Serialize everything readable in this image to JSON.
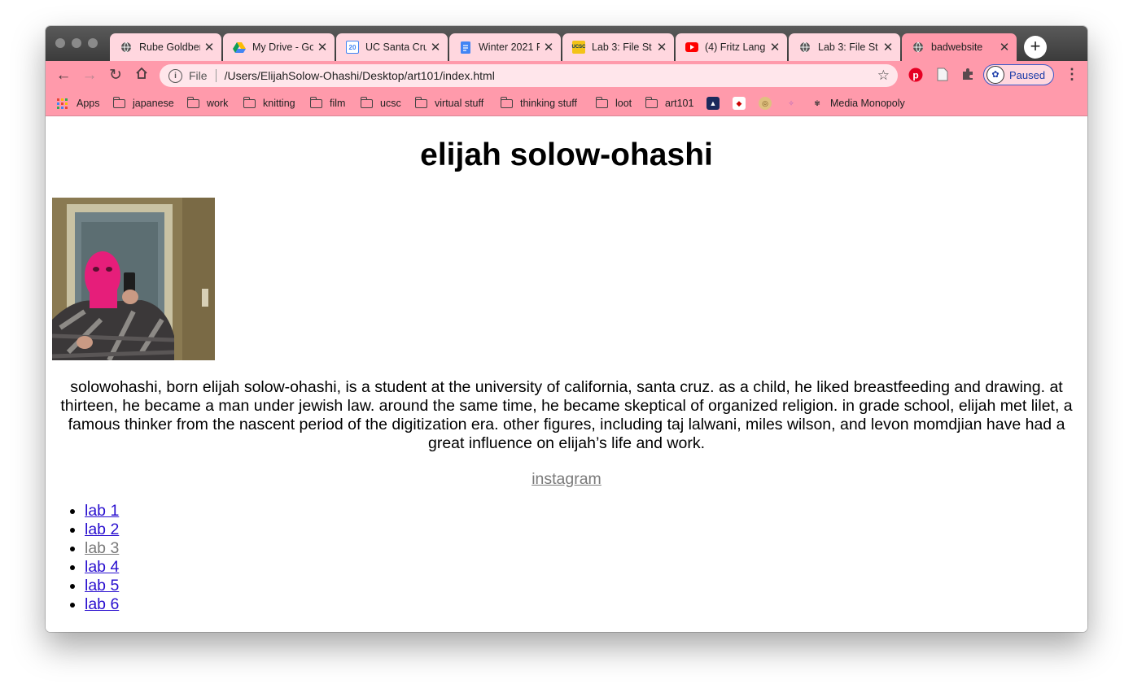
{
  "browser": {
    "tabs": [
      {
        "title": "Rube Goldberg",
        "favicon": "globe-icon"
      },
      {
        "title": "My Drive - Go",
        "favicon": "google-drive-icon"
      },
      {
        "title": "UC Santa Cru",
        "favicon": "google-calendar-icon",
        "favicon_text": "20"
      },
      {
        "title": "Winter 2021 F",
        "favicon": "google-docs-icon"
      },
      {
        "title": "Lab 3: File St",
        "favicon": "ucsc-icon",
        "favicon_text": "UCSC"
      },
      {
        "title": "(4) Fritz Lang",
        "favicon": "youtube-icon"
      },
      {
        "title": "Lab 3: File St",
        "favicon": "globe-icon"
      },
      {
        "title": "badwebsite",
        "favicon": "globe-icon",
        "active": true
      }
    ],
    "close_glyph": "✕",
    "new_tab_glyph": "+",
    "address": {
      "scheme": "File",
      "url": "/Users/ElijahSolow-Ohashi/Desktop/art101/index.html"
    },
    "profile": {
      "label": "Paused"
    },
    "bookmarks": [
      {
        "label": "Apps",
        "icon": "apps-grid-icon"
      },
      {
        "label": "japanese",
        "icon": "folder-icon"
      },
      {
        "label": "work",
        "icon": "folder-icon"
      },
      {
        "label": "knitting",
        "icon": "folder-icon"
      },
      {
        "label": "film",
        "icon": "folder-icon"
      },
      {
        "label": "ucsc",
        "icon": "folder-icon"
      },
      {
        "label": "virtual stuff",
        "icon": "folder-icon"
      },
      {
        "label": "thinking stuff",
        "icon": "folder-icon"
      },
      {
        "label": "loot",
        "icon": "folder-icon"
      },
      {
        "label": "art101",
        "icon": "folder-icon"
      },
      {
        "label": "Media Monopoly",
        "icon": "tree-icon"
      }
    ],
    "colors": {
      "theme_pink": "#ff9aab",
      "tab_pink": "#ffd7df",
      "link_blue": "#2a10cf",
      "visited_gray": "#7a7a7a"
    }
  },
  "page": {
    "title": "elijah solow-ohashi",
    "bio": "solowohashi, born elijah solow-ohashi, is a student at the university of california, santa cruz. as a child, he liked breastfeeding and drawing. at thirteen, he became a man under jewish law. around the same time, he became skeptical of organized religion. in grade school, elijah met lilet, a famous thinker from the nascent period of the digitization era. other figures, including taj lalwani, miles wilson, and levon momdjian have had a great influence on elijah’s life and work.",
    "instagram_link": "instagram",
    "labs": [
      {
        "label": "lab 1",
        "visited": false
      },
      {
        "label": "lab 2",
        "visited": false
      },
      {
        "label": "lab 3",
        "visited": true
      },
      {
        "label": "lab 4",
        "visited": false
      },
      {
        "label": "lab 5",
        "visited": false
      },
      {
        "label": "lab 6",
        "visited": false
      }
    ]
  }
}
